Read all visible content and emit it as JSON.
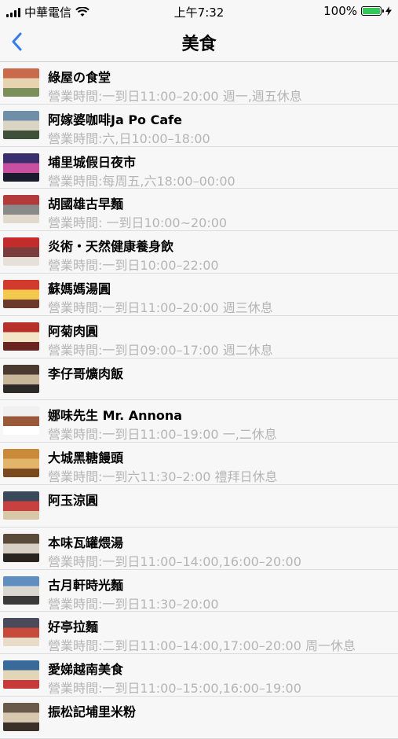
{
  "status_bar": {
    "carrier": "中華電信",
    "time": "上午7:32",
    "battery": "100%",
    "battery_level": 1.0
  },
  "nav": {
    "back_icon": "chevron-left-icon",
    "title": "美食",
    "accent": "#2f7cf6"
  },
  "items": [
    {
      "name": "綠屋の食堂",
      "hours": "營業時間:一到日11:00–20:00 週一,週五休息",
      "thumb": [
        "#c96a4a",
        "#e8d3b0",
        "#7a8f5a"
      ]
    },
    {
      "name": "阿嫁婆咖啡Ja Po Cafe",
      "hours": "營業時間:六,日10:00–18:00",
      "thumb": [
        "#6f8fa8",
        "#d9d4c4",
        "#3e4f3a"
      ]
    },
    {
      "name": "埔里城假日夜市",
      "hours": "營業時間:每周五,六18:00–00:00",
      "thumb": [
        "#3a2f6e",
        "#c94fa0",
        "#1b1b2e"
      ]
    },
    {
      "name": "胡國雄古早麵",
      "hours": "營業時間: 一到日10:00~20:00",
      "thumb": [
        "#b33a3a",
        "#8a8a8a",
        "#e0d9cc"
      ]
    },
    {
      "name": "炎術・天然健康養身飲",
      "hours": "營業時間:一到日10:00–22:00",
      "thumb": [
        "#c42b2b",
        "#7a3c3c",
        "#e6e0d8"
      ]
    },
    {
      "name": "蘇媽媽湯圓",
      "hours": "營業時間:一到日11:00–20:00 週三休息",
      "thumb": [
        "#d23b2b",
        "#f2c94c",
        "#6b3a2a"
      ]
    },
    {
      "name": "阿菊肉圓",
      "hours": "營業時間:一到日09:00–17:00 週二休息",
      "thumb": [
        "#b8302a",
        "#f3e6c8",
        "#6a2420"
      ]
    },
    {
      "name": "李仔哥爌肉飯",
      "hours": "",
      "thumb": [
        "#4a3a30",
        "#c9b79a",
        "#2e2a28"
      ]
    },
    {
      "name": "娜味先生 Mr. Annona",
      "hours": "營業時間:一到日11:00–19:00 一,二休息",
      "thumb": [
        "#f0f0f0",
        "#9a5a3a",
        "#ffffff"
      ]
    },
    {
      "name": "大城黑糖饅頭",
      "hours": "營業時間:一到六11:30–2:00 禮拜日休息",
      "thumb": [
        "#c98a3a",
        "#e2b56a",
        "#7a4a1e"
      ]
    },
    {
      "name": "阿玉涼圓",
      "hours": "",
      "thumb": [
        "#3a4a5a",
        "#c94040",
        "#d8c8a8"
      ]
    },
    {
      "name": "本味瓦罐煨湯",
      "hours": "營業時間:一到日11:00–14:00,16:00–20:00",
      "thumb": [
        "#5a4a3a",
        "#d8d0c4",
        "#2a2420"
      ]
    },
    {
      "name": "古月軒時光麵",
      "hours": "營業時間:一到日11:30–20:00",
      "thumb": [
        "#5f8fc0",
        "#d8d8d0",
        "#3a3a3a"
      ]
    },
    {
      "name": "好亭拉麵",
      "hours": "營業時間:二到日11:00–14:00,17:00–20:00 周一休息",
      "thumb": [
        "#4a4a5a",
        "#c84a3a",
        "#e8dcc8"
      ]
    },
    {
      "name": "愛娣越南美食",
      "hours": "營業時間:一到日11:00–15:00,16:00–19:00",
      "thumb": [
        "#3a6a9a",
        "#e2d6b8",
        "#c83a3a"
      ]
    },
    {
      "name": "振松記埔里米粉",
      "hours": "",
      "thumb": [
        "#6a5a4a",
        "#d8c8b0",
        "#3a3028"
      ]
    }
  ]
}
